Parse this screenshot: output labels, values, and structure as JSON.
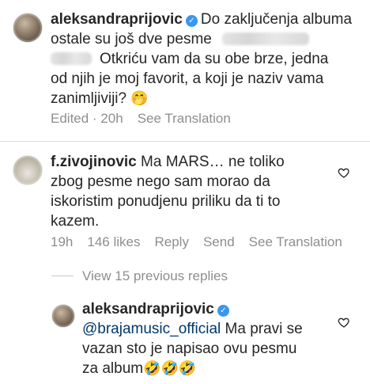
{
  "comments": [
    {
      "username": "aleksandraprijovic",
      "text_part1": "Do zaključenja albuma",
      "text_line2": "ostale su još dve pesme",
      "text_line3": "Otkriću vam da su obe brze, jedna",
      "text_line4": "od njih je moj favorit, a koji je naziv vama",
      "text_line5": "zanimljiviji?",
      "emoji": "🤭",
      "meta_edited": "Edited · 20h",
      "meta_see_translation": "See Translation"
    },
    {
      "username": "f.zivojinovic",
      "text_part1": "Ma MARS… ne toliko",
      "text_line2": "zbog pesme nego sam morao da",
      "text_line3": "iskoristim ponudjenu priliku da ti to",
      "text_line4": "kazem.",
      "meta_time": "19h",
      "meta_likes": "146 likes",
      "meta_reply": "Reply",
      "meta_send": "Send",
      "meta_see_translation": "See Translation"
    },
    {
      "username": "aleksandraprijovic",
      "mention": "@brajamusic_official",
      "text_part1": "Ma pravi se",
      "text_line2": "vazan sto je napisao ovu pesmu",
      "text_line3": "za album",
      "emoji": "🤣🤣🤣"
    }
  ],
  "view_replies": "View 15 previous replies",
  "icons": {
    "verified": "verified-badge-icon",
    "heart": "heart-outline-icon"
  },
  "colors": {
    "verified": "#3897f0",
    "meta": "#8e8e8e",
    "mention": "#00376b"
  }
}
